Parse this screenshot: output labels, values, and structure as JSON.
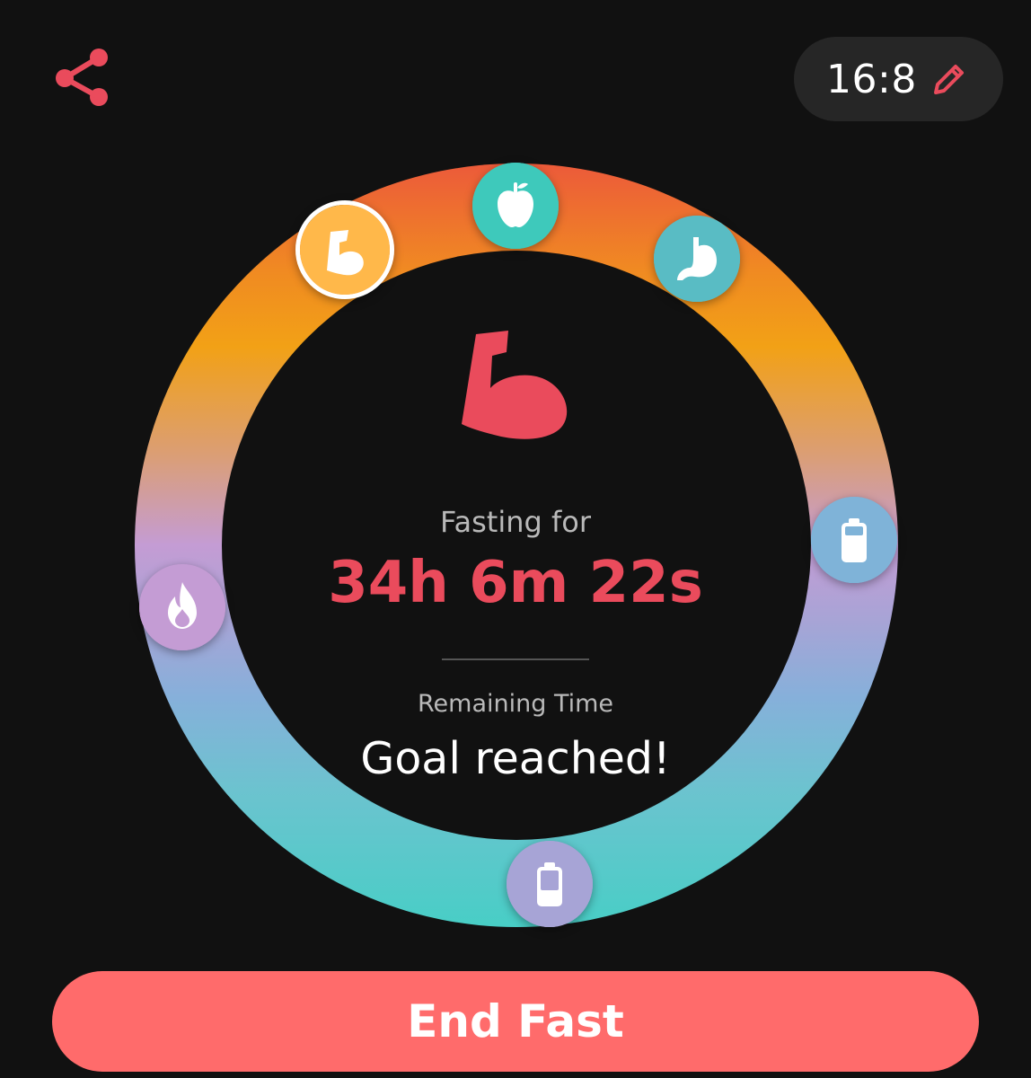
{
  "header": {
    "share_icon": "share-icon",
    "fasting_plan": "16:8",
    "edit_icon": "pencil-icon"
  },
  "colors": {
    "accent_red": "#ea4b5c",
    "button": "#ff6b6b",
    "background": "#111111",
    "pill_background": "#262626"
  },
  "ring": {
    "milestones": [
      {
        "icon": "muscle-icon",
        "color": "#ffb84a",
        "active": true
      },
      {
        "icon": "apple-icon",
        "color": "#3ec9bb",
        "active": false
      },
      {
        "icon": "stomach-icon",
        "color": "#59bcc4",
        "active": false
      },
      {
        "icon": "battery-full-icon",
        "color": "#7fb3d8",
        "active": false
      },
      {
        "icon": "battery-icon",
        "color": "#a7a4d6",
        "active": false
      },
      {
        "icon": "flame-icon",
        "color": "#c49cd4",
        "active": false
      }
    ],
    "current_stage_icon": "muscle-icon"
  },
  "status": {
    "fasting_label": "Fasting for",
    "elapsed": "34h 6m 22s",
    "remaining_label": "Remaining Time",
    "remaining_value": "Goal reached!"
  },
  "actions": {
    "end_fast_label": "End Fast"
  }
}
